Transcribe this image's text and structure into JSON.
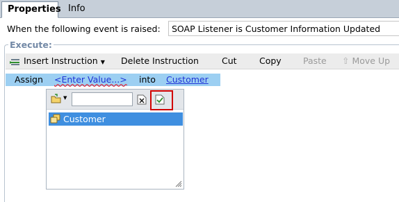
{
  "tabs": [
    {
      "label": "Properties",
      "active": true
    },
    {
      "label": "Info",
      "active": false
    }
  ],
  "event": {
    "label": "When the following event is raised:",
    "value": "SOAP Listener is Customer Information Updated"
  },
  "execute": {
    "legend": "Execute:"
  },
  "toolbar": {
    "insert_label": "Insert Instruction",
    "delete_label": "Delete Instruction",
    "cut_label": "Cut",
    "copy_label": "Copy",
    "paste_label": "Paste",
    "move_up_label": "Move Up"
  },
  "instruction": {
    "keyword": "Assign",
    "value_placeholder": "<Enter Value...>",
    "connector": "into",
    "target": "Customer"
  },
  "picker": {
    "search_value": "",
    "items": [
      {
        "label": "Customer",
        "selected": true
      }
    ]
  },
  "colors": {
    "tab_bar": "#c6cfd9",
    "legend": "#7389a6",
    "assign_row": "#9ccff2",
    "link": "#1f33d6",
    "selection": "#3f8fe0",
    "highlight": "#d10000"
  }
}
